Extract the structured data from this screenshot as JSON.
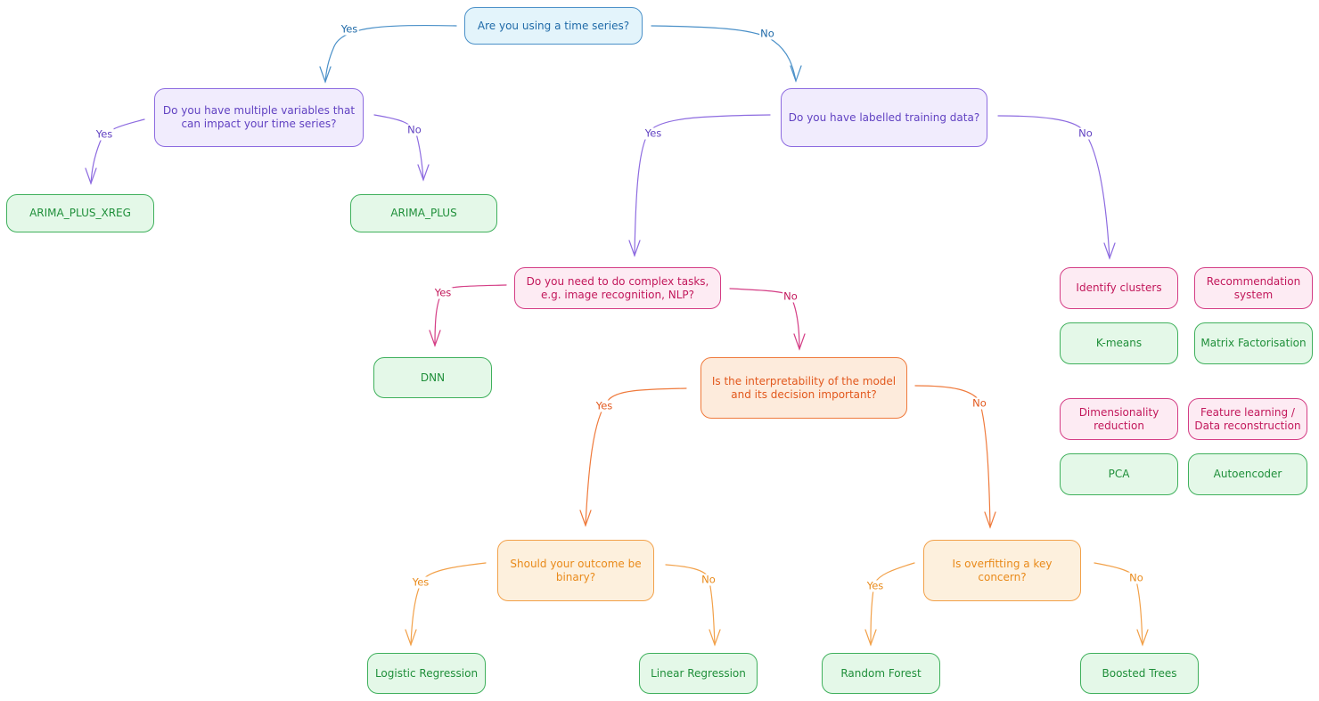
{
  "diagram": {
    "type": "decision-tree",
    "nodes": {
      "q_timeseries": "Are you using a time series?",
      "q_multivar": "Do you have multiple variables that can impact your time series?",
      "arima_xreg": "ARIMA_PLUS_XREG",
      "arima_plus": "ARIMA_PLUS",
      "q_labelled": "Do you have labelled training data?",
      "q_complex": "Do you need to do complex tasks, e.g. image recognition, NLP?",
      "dnn": "DNN",
      "q_interpret": "Is the interpretability of the model and its decision important?",
      "q_binary": "Should your outcome be binary?",
      "logistic": "Logistic Regression",
      "linear": "Linear Regression",
      "q_overfit": "Is overfitting a key concern?",
      "random_forest": "Random Forest",
      "boosted": "Boosted Trees",
      "task_clusters": "Identify clusters",
      "task_reco": "Recommendation system",
      "kmeans": "K-means",
      "matrix_fact": "Matrix Factorisation",
      "task_dimred": "Dimensionality reduction",
      "task_feature": "Feature learning / Data reconstruction",
      "pca": "PCA",
      "autoencoder": "Autoencoder"
    },
    "edge_labels": {
      "yes": "Yes",
      "no": "No"
    },
    "edges": [
      {
        "from": "q_timeseries",
        "to": "q_multivar",
        "label": "Yes"
      },
      {
        "from": "q_timeseries",
        "to": "q_labelled",
        "label": "No"
      },
      {
        "from": "q_multivar",
        "to": "arima_xreg",
        "label": "Yes"
      },
      {
        "from": "q_multivar",
        "to": "arima_plus",
        "label": "No"
      },
      {
        "from": "q_labelled",
        "to": "q_complex",
        "label": "Yes"
      },
      {
        "from": "q_labelled",
        "to": "task_clusters",
        "label": "No"
      },
      {
        "from": "q_complex",
        "to": "dnn",
        "label": "Yes"
      },
      {
        "from": "q_complex",
        "to": "q_interpret",
        "label": "No"
      },
      {
        "from": "q_interpret",
        "to": "q_binary",
        "label": "Yes"
      },
      {
        "from": "q_interpret",
        "to": "q_overfit",
        "label": "No"
      },
      {
        "from": "q_binary",
        "to": "logistic",
        "label": "Yes"
      },
      {
        "from": "q_binary",
        "to": "linear",
        "label": "No"
      },
      {
        "from": "q_overfit",
        "to": "random_forest",
        "label": "Yes"
      },
      {
        "from": "q_overfit",
        "to": "boosted",
        "label": "No"
      }
    ],
    "colors": {
      "blue": "#4a90c8",
      "purple": "#8d6be0",
      "pink": "#d43d85",
      "orange_dark": "#ef7a3c",
      "orange_light": "#f2a14a",
      "green": "#3fb05c"
    }
  }
}
